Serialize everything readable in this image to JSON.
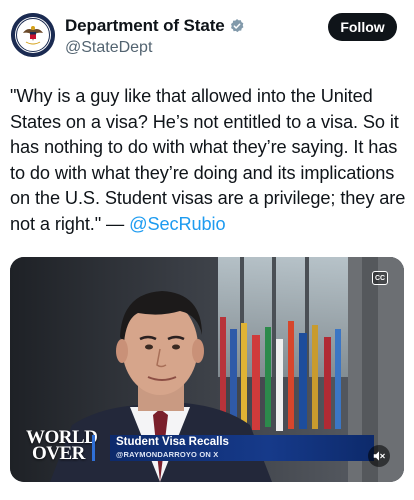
{
  "author": {
    "display_name": "Department of State",
    "handle": "@StateDept",
    "verified": true,
    "verified_badge_color": "#829aab"
  },
  "follow_button": {
    "label": "Follow"
  },
  "tweet": {
    "text": "\"Why is a guy like that allowed into the United States on a visa?  He’s not entitled to a visa.  So it has nothing to do with what they’re saying.  It has to do with what they’re doing and its implications on the U.S.  Student visas are a privilege; they are not a right.\" — ",
    "mention": "@SecRubio",
    "mention_color": "#1d9bf0"
  },
  "media": {
    "type": "video",
    "cc_icon": "closed-captions-icon",
    "mute_icon": "speaker-muted-icon",
    "cc_label": "CC",
    "show_logo_line1": "WORLD",
    "show_logo_line2": "OVER",
    "caption_title": "Student Visa Recalls",
    "caption_subtitle": "@RAYMONDARROYO ON X",
    "caption_bar_color": "#163a8a"
  }
}
